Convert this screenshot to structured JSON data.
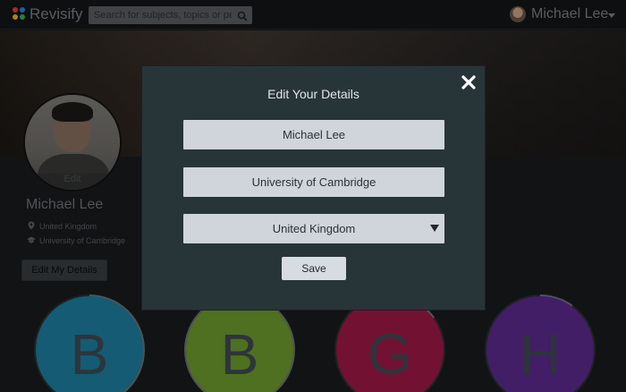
{
  "header": {
    "brand": "Revisify",
    "search_placeholder": "Search for subjects, topics or people",
    "user_name": "Michael Lee"
  },
  "profile": {
    "photo_edit_label": "Edit",
    "name": "Michael Lee",
    "location": "United Kingdom",
    "university": "University of Cambridge",
    "edit_button_label": "Edit My Details"
  },
  "subjects": [
    {
      "letter": "B",
      "color": "#1c7fa0",
      "progress": 0.55
    },
    {
      "letter": "B",
      "color": "#6e9a2e",
      "progress": 0.95
    },
    {
      "letter": "G",
      "color": "#a01846",
      "progress": 0.15
    },
    {
      "letter": "H",
      "color": "#5a2a8e",
      "progress": 0.1
    }
  ],
  "modal": {
    "title": "Edit Your Details",
    "name_value": "Michael Lee",
    "university_value": "University of Cambridge",
    "country_value": "United Kingdom",
    "save_label": "Save"
  },
  "colors": {
    "logo_dots": [
      "#e0413a",
      "#2f7fd8",
      "#f2b632",
      "#3aae5a"
    ]
  }
}
